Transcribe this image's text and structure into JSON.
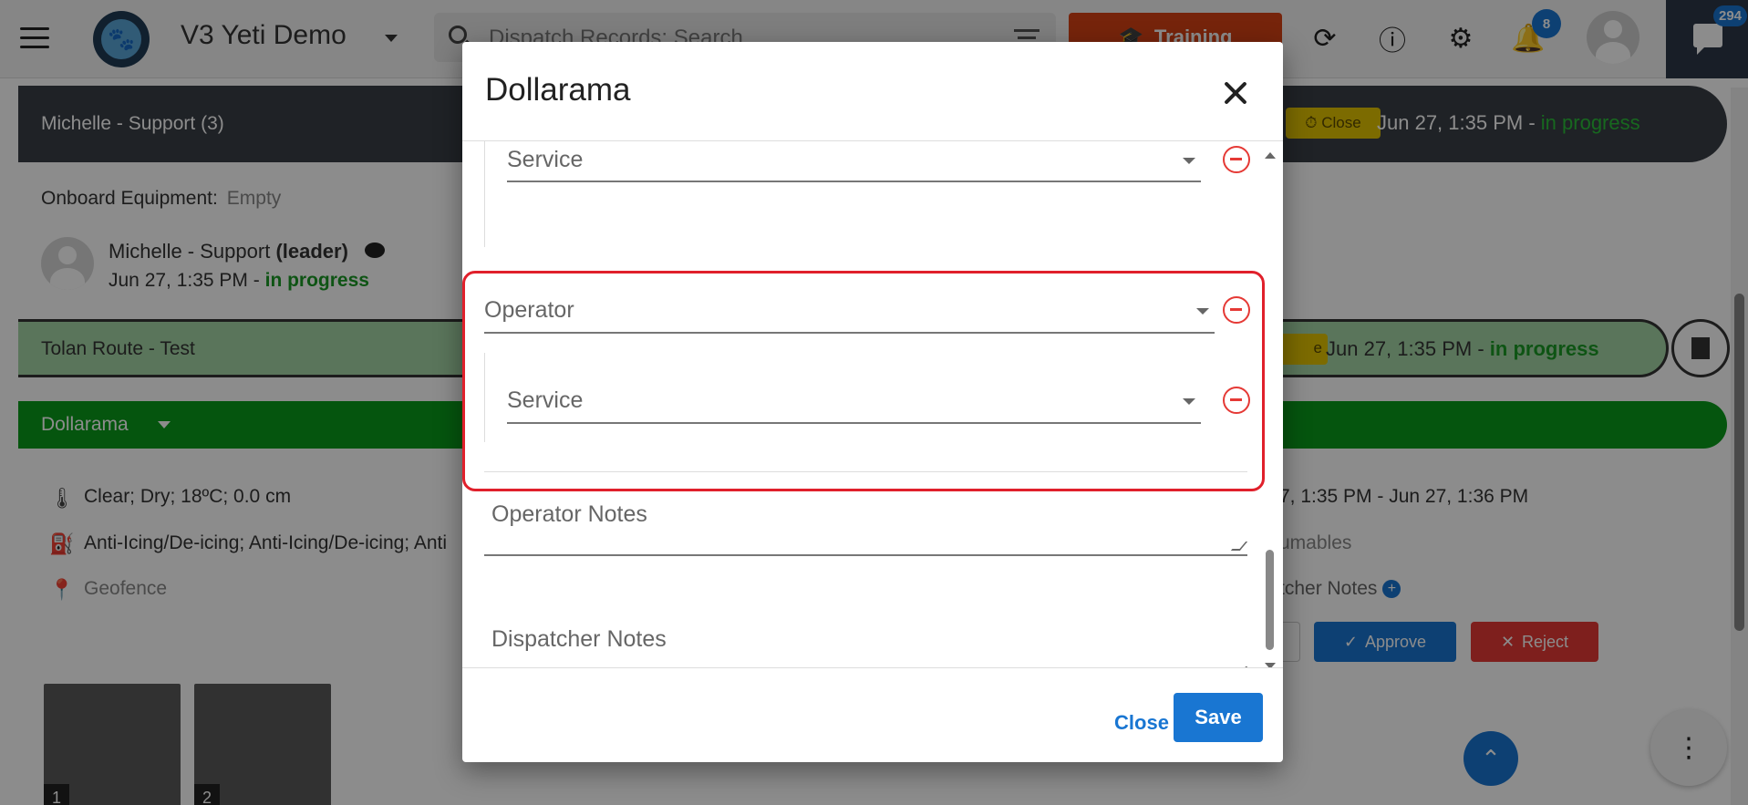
{
  "app": {
    "title": "V3 Yeti Demo",
    "search_placeholder": "Dispatch Records: Search",
    "training_label": "Training",
    "notification_count": "8",
    "chat_count": "294"
  },
  "background": {
    "support": {
      "label": "Michelle - Support (3)",
      "close_label": "Close",
      "time": "Jun 27, 1:35 PM",
      "separator": " - ",
      "status": "in progress"
    },
    "onboard": {
      "label": "Onboard Equipment:",
      "value": "Empty"
    },
    "person": {
      "name": "Michelle - Support",
      "role": "(leader)",
      "time": "Jun 27, 1:35 PM",
      "separator": " - ",
      "status": "in progress"
    },
    "route": {
      "label": "Tolan Route - Test",
      "pill_fragment": "e",
      "time": "Jun 27, 1:35 PM",
      "separator": " - ",
      "status": "in progress"
    },
    "dollarama_bar": {
      "label": "Dollarama"
    },
    "details": {
      "weather": "Clear; Dry; 18ºC; 0.0 cm",
      "services": "Anti-Icing/De-icing; Anti-Icing/De-icing; Anti",
      "geofence": "Geofence",
      "time_range": "7, 1:35 PM - Jun 27, 1:36 PM",
      "consumables_fragment": "umables",
      "dispatcher_notes_fragment": "tcher Notes"
    },
    "actions": {
      "approve": "Approve",
      "reject": "Reject"
    },
    "thumbnails": [
      {
        "num": "1"
      },
      {
        "num": "2"
      }
    ]
  },
  "modal": {
    "title": "Dollarama",
    "fields": {
      "service_top": "Service",
      "operator": "Operator",
      "service_nested": "Service",
      "operator_notes": "Operator Notes",
      "dispatcher_notes": "Dispatcher Notes"
    },
    "close_button": "Close",
    "save_button": "Save"
  },
  "colors": {
    "primary": "#1976d2",
    "danger": "#e53935",
    "highlight_border": "#e0202b",
    "status_green": "#1a9a26",
    "dollarama_green": "#0a9b1a",
    "route_green": "#a5d6a7",
    "training_orange": "#d84315"
  }
}
